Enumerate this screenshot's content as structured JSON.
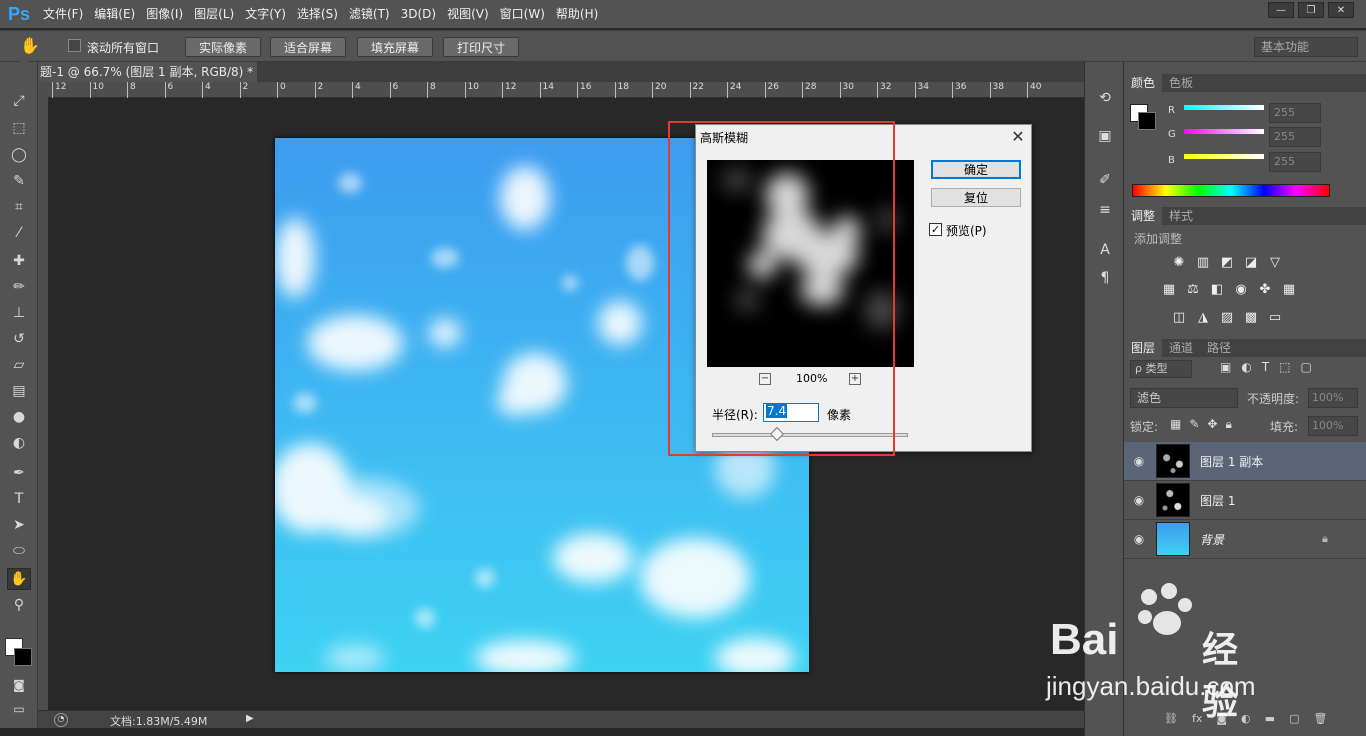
{
  "app": {
    "logo": "Ps"
  },
  "menu": [
    "文件(F)",
    "编辑(E)",
    "图像(I)",
    "图层(L)",
    "文字(Y)",
    "选择(S)",
    "滤镜(T)",
    "3D(D)",
    "视图(V)",
    "窗口(W)",
    "帮助(H)"
  ],
  "window_controls": {
    "minimize": "—",
    "restore": "❐",
    "close": "✕"
  },
  "options": {
    "scroll_all_label": "滚动所有窗口",
    "actual_pixels": "实际像素",
    "fit_screen": "适合屏幕",
    "fill_screen": "填充屏幕",
    "print_size": "打印尺寸",
    "workspace": "基本功能"
  },
  "document": {
    "tab_title": "题-1 @ 66.7% (图层 1 副本, RGB/8) *",
    "tab_close": "×",
    "status": "文档:1.83M/5.49M"
  },
  "ruler_labels": [
    "12",
    "10",
    "8",
    "6",
    "4",
    "2",
    "0",
    "2",
    "4",
    "6",
    "8",
    "10",
    "12",
    "14",
    "16",
    "18",
    "20",
    "22",
    "24",
    "26",
    "28",
    "30",
    "32",
    "34",
    "36",
    "38",
    "40"
  ],
  "color_panel": {
    "tabs": [
      "颜色",
      "色板"
    ],
    "channels": [
      {
        "label": "R",
        "value": "255"
      },
      {
        "label": "G",
        "value": "255"
      },
      {
        "label": "B",
        "value": "255"
      }
    ]
  },
  "adjust_panel": {
    "tabs": [
      "调整",
      "样式"
    ],
    "title": "添加调整"
  },
  "layers_panel": {
    "tabs": [
      "图层",
      "通道",
      "路径"
    ],
    "filter_kind": "ρ 类型",
    "blend_mode": "滤色",
    "opacity_label": "不透明度:",
    "opacity_value": "100%",
    "lock_label": "锁定:",
    "fill_label": "填充:",
    "fill_value": "100%",
    "layers": [
      {
        "name": "图层 1 副本",
        "selected": true
      },
      {
        "name": "图层 1",
        "selected": false
      },
      {
        "name": "背景",
        "selected": false
      }
    ]
  },
  "dialog": {
    "title": "高斯模糊",
    "ok": "确定",
    "reset": "复位",
    "preview_label": "预览(P)",
    "preview_checked": true,
    "zoom": "100%",
    "zoom_out": "−",
    "zoom_in": "+",
    "radius_label": "半径(R):",
    "radius_value": "7.4",
    "radius_unit": "像素",
    "radius_slider_fraction": 0.33
  },
  "watermark": {
    "brand": "Bai",
    "brand2": "经验",
    "url": "jingyan.baidu.com"
  },
  "colors": {
    "ui_dark": "#535353",
    "accent_red": "#e53935",
    "sky_top": "#3d9cf0",
    "sky_bottom": "#3ed0f2"
  }
}
